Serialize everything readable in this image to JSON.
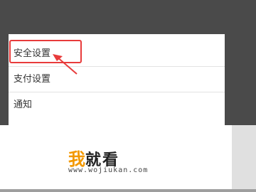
{
  "menu": {
    "items": [
      {
        "label": "安全设置"
      },
      {
        "label": "支付设置"
      },
      {
        "label": "通知"
      }
    ]
  },
  "watermark": {
    "logo_char1": "我",
    "logo_rest": "就看",
    "url": "www.wojiukan.com"
  },
  "colors": {
    "highlight": "#e83b3b",
    "logo_accent": "#f39800",
    "overlay_background": "#4a4a4a"
  }
}
